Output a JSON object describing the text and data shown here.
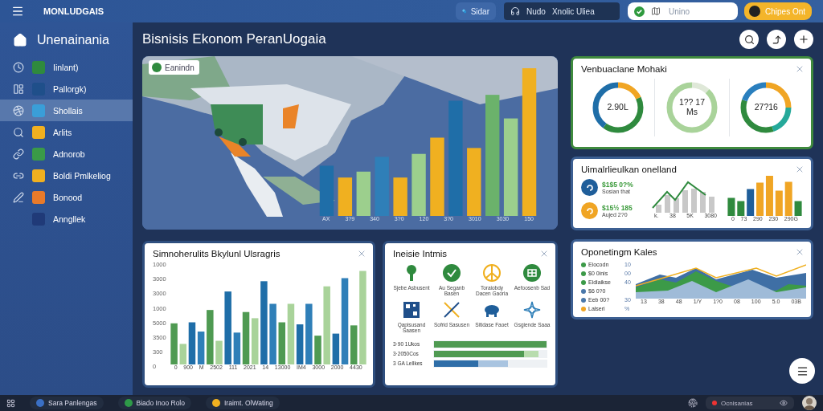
{
  "top_bar": {
    "brand": "MONLUDGAIS",
    "chip": "Sidar",
    "media": {
      "primary": "Nudo",
      "secondary": "Xnolic Uliea"
    },
    "search": {
      "placeholder": "Unino"
    },
    "action": "Chipes Ont"
  },
  "sidebar": {
    "title": "Unenainania",
    "items": [
      {
        "label": "Iinlant)",
        "selected": false
      },
      {
        "label": "Pallorgk)",
        "selected": false
      },
      {
        "label": "Shollais",
        "selected": true
      },
      {
        "label": "Arlits",
        "selected": false
      },
      {
        "label": "Adnorob",
        "selected": false
      },
      {
        "label": "Boldi Pmlkeliog",
        "selected": false
      },
      {
        "label": "Bonood",
        "selected": false
      },
      {
        "label": "Anngllek",
        "selected": false
      }
    ]
  },
  "page_title": "Bisnisis Ekonom PeranUogaia",
  "map_panel": {
    "chip": "Eanindn",
    "x_labels": [
      "AX",
      "3?9",
      "340",
      "3?0",
      "120",
      "3?0",
      "3010",
      "3030",
      "150"
    ]
  },
  "donut_card": {
    "title": "Venbuaclane Mohaki",
    "donuts": [
      {
        "value": "2.90L"
      },
      {
        "value": "1?? 17 Ms"
      },
      {
        "value": "27?16"
      }
    ]
  },
  "stats_card": {
    "title": "Uimalrlieulkan onelland",
    "stats": [
      {
        "figure": "$1$5 0?%",
        "caption": "Sosian that",
        "color": "#1f5e9a"
      },
      {
        "figure": "$15½ 185",
        "caption": "Aujed 2?0",
        "color": "#f0a524"
      }
    ],
    "line_x_labels": [
      "k.",
      "38",
      "5K",
      "3080"
    ],
    "bar_x_labels": [
      "0",
      "73",
      "290",
      "230",
      "290G"
    ]
  },
  "area_card": {
    "title": "Oponetingm Kales",
    "legend": [
      {
        "label": "Eiocodn",
        "value": "10",
        "color": "#3c9a48"
      },
      {
        "label": "$0 0inis",
        "value": "00",
        "color": "#3c9a48"
      },
      {
        "label": "Eidiaikse",
        "value": "40",
        "color": "#3c9a48"
      },
      {
        "label": "$6 0?0",
        "color": "#4a78aa"
      },
      {
        "label": "Eeb 00?",
        "value": "30",
        "color": "#4a78aa"
      },
      {
        "label": "Lalseri",
        "value": "%",
        "color": "#f0a524"
      }
    ],
    "x_labels": [
      "13",
      "38",
      "48",
      "1/Y",
      "1?0",
      "08",
      "100",
      "5.0",
      "03B"
    ]
  },
  "bars_card": {
    "title": "Simnoherulits Bkylunl Ulsragris",
    "y_labels": [
      "1000",
      "3000",
      "3000",
      "1000",
      "5000",
      "3500",
      "300",
      "0"
    ],
    "x_labels": [
      "0",
      "900",
      "M",
      "2502",
      "111",
      "2021",
      "14",
      "13000",
      "IM4",
      "3000",
      "2000",
      "4430"
    ]
  },
  "icons_card": {
    "title": "Ineisie Intmis",
    "tiles": [
      {
        "label": "Sjebe Asbusent"
      },
      {
        "label": "Au Seganb Basen"
      },
      {
        "label": "Toraiobdy Dacen Gaoria"
      },
      {
        "label": "Aefoosenb Sad"
      },
      {
        "label": "Qapisusand Saasen"
      },
      {
        "label": "Sofrid Sasusen"
      },
      {
        "label": "Sitidase Faoet"
      },
      {
        "label": "Gsgiende Saaa"
      }
    ],
    "bars": [
      {
        "label": "3·90 1Ukos",
        "level": 1.0
      },
      {
        "label": "3·2050Cos",
        "level": 0.8
      },
      {
        "label": "3 GA Lellkes",
        "level": 0.39
      }
    ]
  },
  "taskbar": {
    "apps": [
      {
        "label": "Sara Panlengas",
        "color": "#3a6fc4"
      },
      {
        "label": "Biado Inoo Rolo",
        "color": "#2e9a48"
      },
      {
        "label": "Iraimt. OlWating",
        "color": "#f0b020"
      }
    ],
    "status": "Ocnisanias"
  }
}
